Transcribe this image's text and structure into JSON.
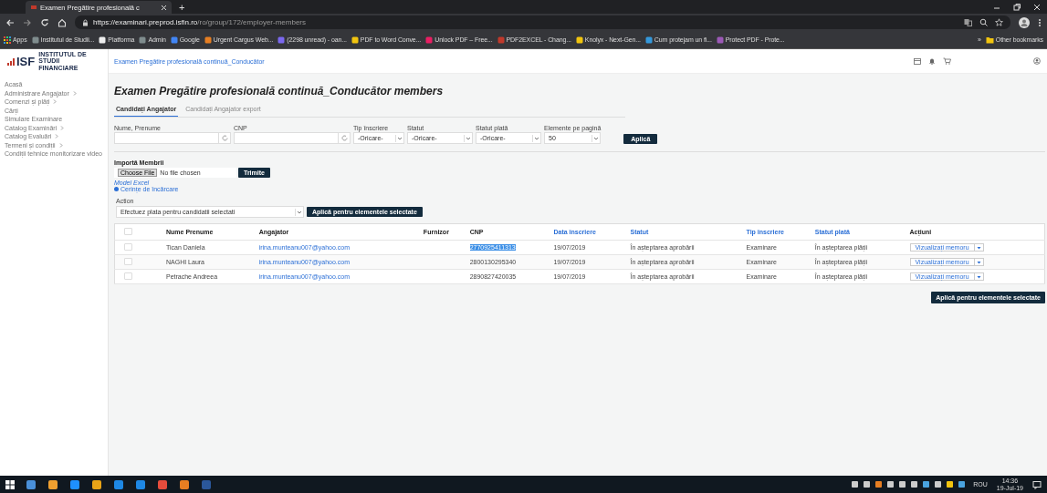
{
  "browser": {
    "tab_title": "Examen Pregătire profesională c",
    "new_tab": "+",
    "url_host": "https://examinari.preprod.isfin.ro",
    "url_path": "/ro/group/172/employer-members",
    "bookmarks": [
      "Apps",
      "Institutul de Studii...",
      "Platforma",
      "Admin",
      "Google",
      "Urgent Cargus Web...",
      "(2298 unread) - oan...",
      "PDF to Word Conve...",
      "Unlock PDF – Free...",
      "PDF2EXCEL - Chang...",
      "Knolyx - Next-Gen...",
      "Cum protejam un fi...",
      "Protect PDF - Prote..."
    ],
    "more": "»",
    "other_bookmarks": "Other bookmarks"
  },
  "logo": {
    "mark": "ISF",
    "tagline": "INSTITUTUL DE STUDII FINANCIARE"
  },
  "breadcrumb": "Examen Pregătire profesională continuă_Conducător",
  "sidebar": {
    "items": [
      {
        "label": "Acasă",
        "submenu": false
      },
      {
        "label": "Administrare Angajator",
        "submenu": true
      },
      {
        "label": "Comenzi și plăți",
        "submenu": true
      },
      {
        "label": "Cărți",
        "submenu": false
      },
      {
        "label": "Simulare Examinare",
        "submenu": false
      },
      {
        "label": "Catalog Examinări",
        "submenu": true
      },
      {
        "label": "Catalog Evaluări",
        "submenu": true
      },
      {
        "label": "Termeni și condiții",
        "submenu": true
      },
      {
        "label": "Condiții tehnice monitorizare video",
        "submenu": false
      }
    ]
  },
  "title": "Examen Pregătire profesională continuă_Conducător members",
  "tabs": [
    {
      "label": "Candidați Angajator",
      "selected": true
    },
    {
      "label": "Candidați Angajator export",
      "selected": false
    }
  ],
  "filters": [
    {
      "kind": "text",
      "label": "Nume, Prenume"
    },
    {
      "kind": "text",
      "label": "CNP"
    },
    {
      "kind": "select",
      "label": "Tip înscriere",
      "value": "-Oricare-"
    },
    {
      "kind": "select",
      "label": "Statut",
      "value": "-Oricare-"
    },
    {
      "kind": "select",
      "label": "Statut plată",
      "value": "-Oricare-"
    },
    {
      "kind": "select",
      "label": "Elemente pe pagină",
      "value": "50"
    }
  ],
  "apply": "Aplică",
  "import": {
    "heading": "Importă Membrii",
    "choose": "Choose File",
    "file": "No file chosen",
    "submit": "Trimite",
    "model_link": "Model Excel",
    "requirements_link": "Cerințe de încărcare"
  },
  "action": {
    "label": "Action",
    "value": "Efectuez plata pentru candidatii selectati",
    "button": "Aplică pentru elementele selectate"
  },
  "table": {
    "all_checked": false,
    "columns": [
      {
        "label": "Nume Prenume",
        "link": false
      },
      {
        "label": "Angajator",
        "link": false
      },
      {
        "label": "Furnizor",
        "link": false
      },
      {
        "label": "CNP",
        "link": false
      },
      {
        "label": "Data înscriere",
        "link": true
      },
      {
        "label": "Statut",
        "link": true
      },
      {
        "label": "Tip înscriere",
        "link": true
      },
      {
        "label": "Statut plată",
        "link": true
      },
      {
        "label": "Acțiuni",
        "link": false
      }
    ],
    "rows": [
      {
        "checked": false,
        "name": "Tican Daniela",
        "employer": "irina.munteanu007@yahoo.com",
        "supplier": "",
        "cnp": "2770925411313",
        "cnp_highlighted": true,
        "date": "19/07/2019",
        "status": "În așteptarea aprobării",
        "type": "Examinare",
        "payment": "În așteptarea plății",
        "action": "Vizualizați memoru"
      },
      {
        "checked": false,
        "name": "NAGHI Laura",
        "employer": "irina.munteanu007@yahoo.com",
        "supplier": "",
        "cnp": "2800130295340",
        "cnp_highlighted": false,
        "date": "19/07/2019",
        "status": "În așteptarea aprobării",
        "type": "Examinare",
        "payment": "În așteptarea plății",
        "action": "Vizualizați memoru"
      },
      {
        "checked": false,
        "name": "Petrache Andreea",
        "employer": "irina.munteanu007@yahoo.com",
        "supplier": "",
        "cnp": "2890827420035",
        "cnp_highlighted": false,
        "date": "19/07/2019",
        "status": "În așteptarea aprobării",
        "type": "Examinare",
        "payment": "În așteptarea plății",
        "action": "Vizualizați memoru"
      }
    ]
  },
  "bottom_button": "Aplică pentru elementele selectate",
  "taskbar": {
    "language": "ROU",
    "time": "14:36",
    "date": "19-Jul-19"
  }
}
